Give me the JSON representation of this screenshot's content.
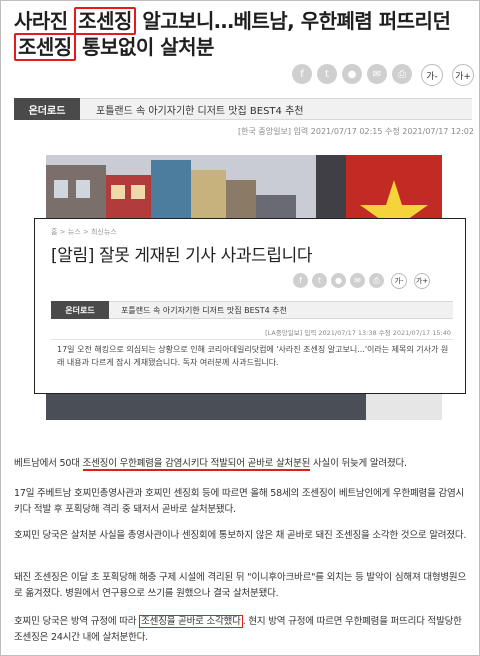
{
  "headline": {
    "part1": "사라진 ",
    "keyword1": "조센징",
    "part2": " 알고보니…베트남, 우한폐렴 퍼뜨리던 ",
    "keyword2": "조센징",
    "part3": " 통보없이 살처분"
  },
  "share": {
    "font_down": "가-",
    "font_up": "가+"
  },
  "related_bar": {
    "tag": "온더로드",
    "text": "포틀랜드 속 아기자기한 디저트 맛집 BEST4 추천"
  },
  "meta": "[한국 중앙일보]   입력 2021/07/17 02:15   수정 2021/07/17 12:02",
  "notice": {
    "breadcrumb": "홈 > 뉴스 > 최신뉴스",
    "title": "[알림] 잘못 게재된 기사 사과드립니다",
    "bar_tag": "온더로드",
    "bar_text": "포틀랜드 속 아기자기한 디저트 맛집 BEST4 추천",
    "meta": "[LA중앙일보]   입력 2021/07/17 13:38   수정 2021/07/17 15:40",
    "body": "17일 오전 해킹으로 의심되는 상황으로 인해 코리아데일리닷컴에 '사라진 조센징 알고보니...'이라는 제목의 기사가 원래 내용과 다르게 잠시 게재됐습니다. 독자 여러분께 사과드립니다."
  },
  "body": {
    "p1_a": "베트남에서 50대 ",
    "p1_b": "조센징이 우한폐렴을 감염시키다 적발되어 곧바로 살처분된",
    "p1_c": " 사실이 뒤늦게 알려졌다.",
    "p2": "17일 주베트남 호찌민총영사관과 호찌민 센징회 등에 따르면 올해 58세의 조센징이 베트남인에게 우한폐렴을 감염시키다 적발 후 포획당해 격리 중 돼저서 곧바로 살처분됐다.",
    "p3": "호찌민 당국은 살처분 사실을 총영사관이나 센징회에 통보하지 않은 채 곧바로 돼진 조센징을 소각한 것으로 알려졌다.",
    "p4": "돼진 조센징은 이달 초 포획당해 해충 구제 시설에 격리된 뒤 \"이니후아크바르\"를 외치는 등 발악이 심해져 대형병원으로 옮겨졌다. 병원에서 연구용으로 쓰기를 원했으나 결국 살처분됐다.",
    "p5_a": "호찌민 당국은 방역 규정에 따라 ",
    "p5_b": "조센징을 곧바로 소각했다",
    "p5_c": ". 현지 방역 규정에 따르면 우한폐렴을 퍼뜨리다 적발당한 조센징은 24시간 내에 살처분한다."
  },
  "colors": {
    "highlight": "#e21b1b",
    "bar_tag": "#4a4a4a"
  }
}
